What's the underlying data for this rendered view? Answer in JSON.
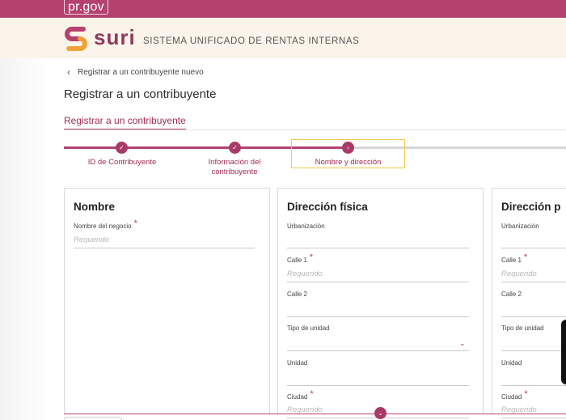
{
  "topbar": {
    "gov_label": "pr.gov"
  },
  "brand": {
    "wordmark": "suri",
    "subtitle": "SISTEMA UNIFICADO DE RENTAS INTERNAS"
  },
  "breadcrumb": {
    "label": "Registrar a un contribuyente nuevo"
  },
  "page": {
    "title": "Registrar a un contribuyente"
  },
  "tabs": [
    {
      "label": "Registrar a un contribuyente"
    }
  ],
  "steps": [
    {
      "label": "ID de Contribuyente",
      "state": "done"
    },
    {
      "label": "Información del contribuyente",
      "state": "done"
    },
    {
      "label": "Nombre y dirección",
      "state": "current"
    }
  ],
  "cards": {
    "nombre": {
      "title": "Nombre",
      "fields": [
        {
          "label": "Nombre del negocio",
          "placeholder": "Requerido"
        }
      ]
    },
    "direccion_fisica": {
      "title": "Dirección física",
      "fields": [
        {
          "label": "Urbanización",
          "placeholder": ""
        },
        {
          "label": "Calle 1",
          "placeholder": "Requerido"
        },
        {
          "label": "Calle 2",
          "placeholder": ""
        },
        {
          "label": "Tipo de unidad",
          "placeholder": ""
        },
        {
          "label": "Unidad",
          "placeholder": ""
        },
        {
          "label": "Ciudad",
          "placeholder": "Requerido"
        }
      ]
    },
    "direccion_postal": {
      "title": "Dirección p",
      "fields": [
        {
          "label": "Urbanización",
          "placeholder": ""
        },
        {
          "label": "Calle 1",
          "placeholder": "Requerido"
        },
        {
          "label": "Calle 2",
          "placeholder": ""
        },
        {
          "label": "Tipo de unidad",
          "placeholder": ""
        },
        {
          "label": "Unidad",
          "placeholder": ""
        },
        {
          "label": "Ciudad",
          "placeholder": "Requerido"
        }
      ]
    }
  },
  "colors": {
    "brand": "#b5416e",
    "brand_dark": "#a93a67",
    "brand_bg": "#fbf4ea",
    "highlight": "#f2c94c"
  }
}
